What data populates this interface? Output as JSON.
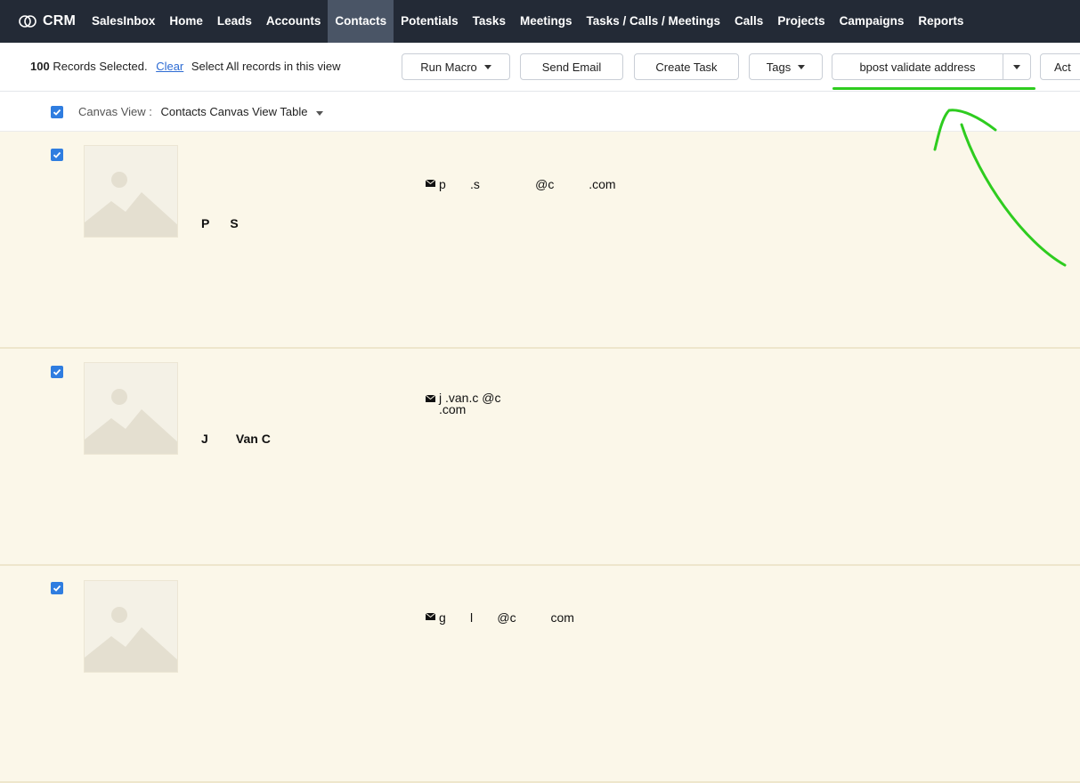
{
  "app": {
    "brand": "CRM"
  },
  "nav": {
    "items": [
      {
        "label": "SalesInbox"
      },
      {
        "label": "Home"
      },
      {
        "label": "Leads"
      },
      {
        "label": "Accounts"
      },
      {
        "label": "Contacts",
        "active": true
      },
      {
        "label": "Potentials"
      },
      {
        "label": "Tasks"
      },
      {
        "label": "Meetings"
      },
      {
        "label": "Tasks / Calls / Meetings"
      },
      {
        "label": "Calls"
      },
      {
        "label": "Projects"
      },
      {
        "label": "Campaigns"
      },
      {
        "label": "Reports"
      }
    ]
  },
  "selection": {
    "count": "100",
    "text": "Records Selected.",
    "clear": "Clear",
    "select_all": "Select All records in this view"
  },
  "toolbar": {
    "run_macro": "Run Macro",
    "send_email": "Send Email",
    "create_task": "Create Task",
    "tags": "Tags",
    "bpost": "bpost validate address",
    "actions_partial": "Act"
  },
  "view": {
    "label": "Canvas View :",
    "name": "Contacts Canvas View Table"
  },
  "records": [
    {
      "name": "P      S",
      "email": "p       .s                @c          .com"
    },
    {
      "name": "J        Van C",
      "email": "j        .van.c                  @c\n.com"
    },
    {
      "name": "",
      "email": "g       l       @c          com"
    }
  ],
  "colors": {
    "nav_bg": "#232a36",
    "active_tab": "#4a5566",
    "checkbox": "#2f7de0",
    "record_bg": "#fbf7e9",
    "highlight": "#2ecc1f"
  }
}
